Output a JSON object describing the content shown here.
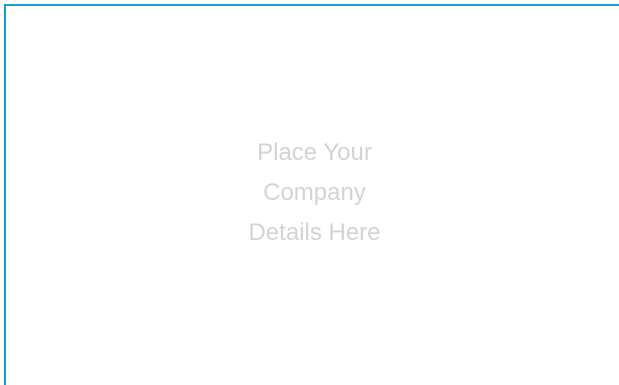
{
  "placeholder": {
    "lines": [
      "Place Your",
      "Company",
      "Details Here"
    ]
  },
  "colors": {
    "border": "#1a9bd1",
    "placeholder_text": "#d3d3d3",
    "background": "#ffffff"
  }
}
